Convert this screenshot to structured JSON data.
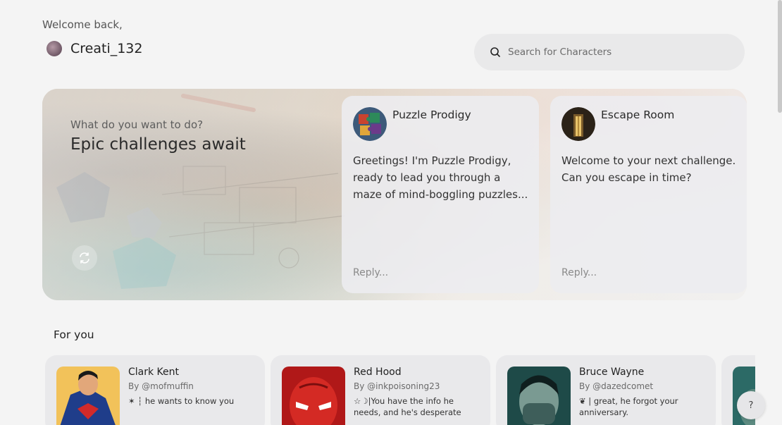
{
  "header": {
    "welcome": "Welcome back,",
    "username": "Creati_132",
    "avatar_icon": "user-avatar-icon"
  },
  "search": {
    "placeholder": "Search for Characters",
    "icon": "search-icon"
  },
  "hero": {
    "subtitle": "What do you want to do?",
    "title": "Epic challenges await",
    "refresh_icon": "refresh-icon"
  },
  "chat_cards": [
    {
      "name": "Puzzle Prodigy",
      "message": "Greetings! I'm Puzzle Prodigy, ready to lead you through a maze of mind-boggling puzzles...",
      "reply_placeholder": "Reply..."
    },
    {
      "name": "Escape Room",
      "message": "Welcome to your next challenge. Can you escape in time?",
      "reply_placeholder": "Reply..."
    }
  ],
  "for_you": {
    "title": "For you",
    "items": [
      {
        "name": "Clark Kent",
        "author": "By @mofmuffin",
        "description": "✶ ┆ he wants to know you"
      },
      {
        "name": "Red Hood",
        "author": "By @inkpoisoning23",
        "description": "☆☽|You have the info he needs, and he's desperate"
      },
      {
        "name": "Bruce Wayne",
        "author": "By @dazedcomet",
        "description": "❦ | great, he forgot your anniversary."
      }
    ]
  },
  "help": {
    "label": "?"
  },
  "colors": {
    "background": "#f4f4f4",
    "card": "#e9e9eb",
    "text": "#222222",
    "muted": "#6a6a6a"
  }
}
